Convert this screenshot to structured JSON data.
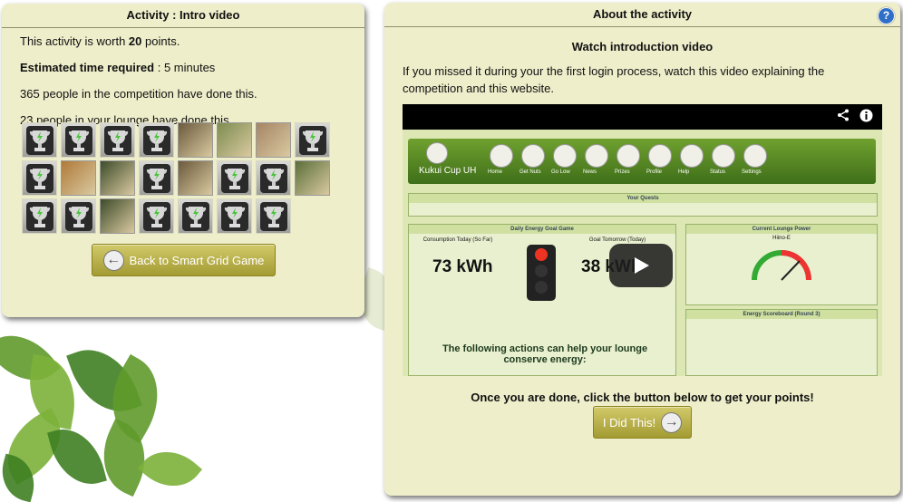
{
  "left_panel": {
    "title": "Activity : Intro video",
    "worth_prefix": "This activity is worth ",
    "worth_points": "20",
    "worth_suffix": " points.",
    "time_label": "Estimated time required",
    "time_value": " : 5 minutes",
    "competition_text": "365 people in the competition have done this.",
    "lounge_text": "23 people in your lounge have done this.",
    "avatars": [
      "trophy",
      "trophy",
      "trophy",
      "trophy",
      "photo",
      "photo",
      "photo",
      "trophy",
      "trophy",
      "photo",
      "photo",
      "trophy",
      "photo",
      "trophy",
      "trophy",
      "photo",
      "trophy",
      "trophy",
      "photo",
      "trophy",
      "trophy",
      "trophy",
      "trophy"
    ],
    "back_button": "Back to Smart Grid Game"
  },
  "right_panel": {
    "title": "About the activity",
    "help_icon": "?",
    "subtitle": "Watch introduction video",
    "description": "If you missed it during your the first login process, watch this video explaining the competition and this website.",
    "video": {
      "share_icon": "share-icon",
      "info_icon": "info-icon",
      "thumbnail": {
        "site_title": "Kukui Cup UH",
        "nav": [
          "Home",
          "Get Nuts",
          "Go Low",
          "News",
          "Prizes",
          "Profile",
          "Help",
          "Status",
          "Settings"
        ],
        "quests_title": "Your Quests",
        "energy_panel_title": "Daily Energy Goal Game",
        "consumption_label": "Consumption Today (So Far)",
        "consumption_value": "73 kWh",
        "goal_label": "Goal Tomorrow (Today)",
        "goal_value": "38 kWh",
        "power_panel_title": "Current Lounge Power",
        "power_lounge": "Hiino-E",
        "scoreboard_title": "Energy Scoreboard (Round 3)",
        "actions_text": "The following actions can help your lounge conserve energy:"
      }
    },
    "done_text": "Once you are done, click the button below to get your points!",
    "did_this_button": "I Did This!"
  },
  "colors": {
    "panel_bg": "#eeeecb",
    "button_olive": "#b0a840",
    "leaf_green": "#5f9a2b"
  }
}
